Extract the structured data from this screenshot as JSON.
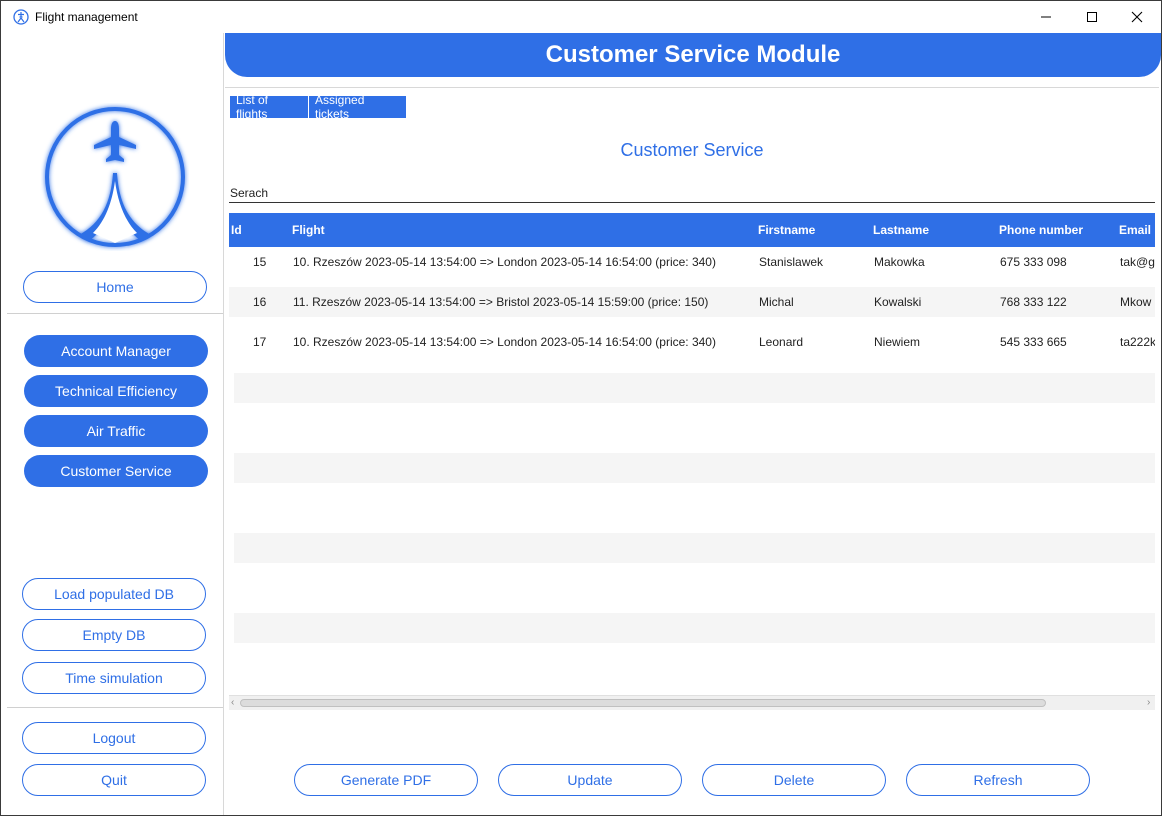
{
  "window": {
    "title": "Flight management"
  },
  "header": {
    "title": "Customer Service Module"
  },
  "sidebar": {
    "home_label": "Home",
    "nav": [
      {
        "label": "Account Manager"
      },
      {
        "label": "Technical Efficiency"
      },
      {
        "label": "Air Traffic"
      },
      {
        "label": "Customer Service"
      }
    ],
    "db": [
      {
        "label": "Load populated DB"
      },
      {
        "label": "Empty DB"
      },
      {
        "label": "Time simulation"
      }
    ],
    "logout_label": "Logout",
    "quit_label": "Quit"
  },
  "tabs": [
    {
      "label": "List of flights"
    },
    {
      "label": "Assigned tickets"
    }
  ],
  "main": {
    "subtitle": "Customer Service",
    "search_label": "Serach"
  },
  "table": {
    "columns": [
      "Id",
      "Flight",
      "Firstname",
      "Lastname",
      "Phone number",
      "Email"
    ],
    "rows": [
      {
        "id": "15",
        "flight": "10. Rzeszów 2023-05-14 13:54:00 => London 2023-05-14 16:54:00 (price: 340)",
        "firstname": "Stanislawek",
        "lastname": "Makowka",
        "phone": "675 333 098",
        "email": "tak@g"
      },
      {
        "id": "16",
        "flight": "11. Rzeszów 2023-05-14 13:54:00 => Bristol 2023-05-14 15:59:00 (price: 150)",
        "firstname": "Michal",
        "lastname": "Kowalski",
        "phone": "768 333 122",
        "email": "Mkow"
      },
      {
        "id": "17",
        "flight": "10. Rzeszów 2023-05-14 13:54:00 => London 2023-05-14 16:54:00 (price: 340)",
        "firstname": "Leonard",
        "lastname": "Niewiem",
        "phone": "545 333 665",
        "email": "ta222k"
      }
    ]
  },
  "actions": [
    {
      "label": "Generate PDF"
    },
    {
      "label": "Update"
    },
    {
      "label": "Delete"
    },
    {
      "label": "Refresh"
    }
  ],
  "colors": {
    "accent": "#2f6fe6",
    "row_alt": "#f5f5f5"
  },
  "icons": {
    "app": "airplane-logo-icon",
    "minimize": "minimize-icon",
    "maximize": "maximize-icon",
    "close": "close-icon"
  }
}
